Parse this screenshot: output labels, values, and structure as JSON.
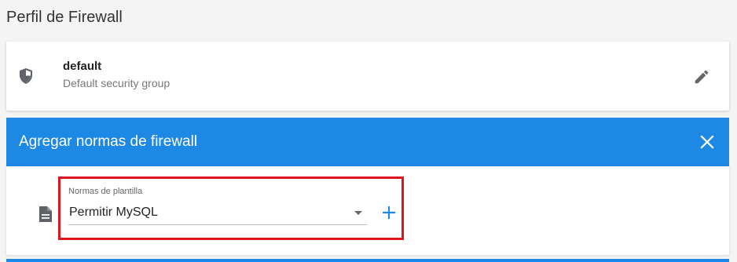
{
  "page": {
    "title": "Perfil de Firewall"
  },
  "profile": {
    "name": "default",
    "description": "Default security group",
    "icons": {
      "shield": "shield-icon",
      "edit": "pencil-edit-icon"
    }
  },
  "panel": {
    "title": "Agregar normas de firewall",
    "close_icon": "close-icon",
    "accent_color": "#1e88e5",
    "template_field": {
      "label": "Normas de plantilla",
      "selected_value": "Permitir MySQL",
      "doc_icon": "document-icon",
      "add_icon": "plus-icon",
      "highlight_color": "#e0141e"
    }
  }
}
